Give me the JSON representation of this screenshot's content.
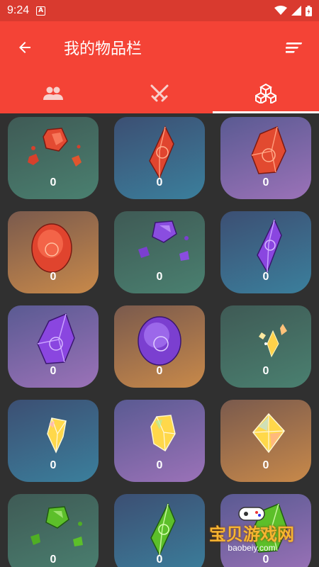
{
  "status_bar": {
    "time": "9:24",
    "notification_icon": "a-icon"
  },
  "app_bar": {
    "title": "我的物品栏",
    "back_icon": "arrow-left-icon",
    "menu_icon": "sort-icon"
  },
  "tabs": [
    {
      "icon": "people-icon",
      "active": false
    },
    {
      "icon": "crossed-swords-icon",
      "active": false
    },
    {
      "icon": "boxes-icon",
      "active": true
    }
  ],
  "items": [
    {
      "gem": "red-shards",
      "bg": "green",
      "count": "0"
    },
    {
      "gem": "red-crystal",
      "bg": "blue",
      "count": "0"
    },
    {
      "gem": "red-chunk",
      "bg": "purple",
      "count": "0"
    },
    {
      "gem": "red-gem",
      "bg": "gold",
      "count": "0"
    },
    {
      "gem": "purple-shards",
      "bg": "green",
      "count": "0"
    },
    {
      "gem": "purple-crystal",
      "bg": "blue",
      "count": "0"
    },
    {
      "gem": "purple-chunk",
      "bg": "purple",
      "count": "0"
    },
    {
      "gem": "purple-gem",
      "bg": "gold",
      "count": "0"
    },
    {
      "gem": "gold-shards",
      "bg": "green",
      "count": "0"
    },
    {
      "gem": "gold-crystal",
      "bg": "blue",
      "count": "0"
    },
    {
      "gem": "gold-chunk",
      "bg": "purple",
      "count": "0"
    },
    {
      "gem": "gold-gem",
      "bg": "gold",
      "count": "0"
    },
    {
      "gem": "green-shards",
      "bg": "green",
      "count": "0"
    },
    {
      "gem": "green-crystal",
      "bg": "blue",
      "count": "0"
    },
    {
      "gem": "green-chunk",
      "bg": "purple",
      "count": "0"
    }
  ],
  "watermark": {
    "text": "宝贝游戏网",
    "url": "baobeiy.com"
  },
  "colors": {
    "app_bar": "#f44336",
    "status_bar": "#d93a2f",
    "background": "#303030"
  }
}
